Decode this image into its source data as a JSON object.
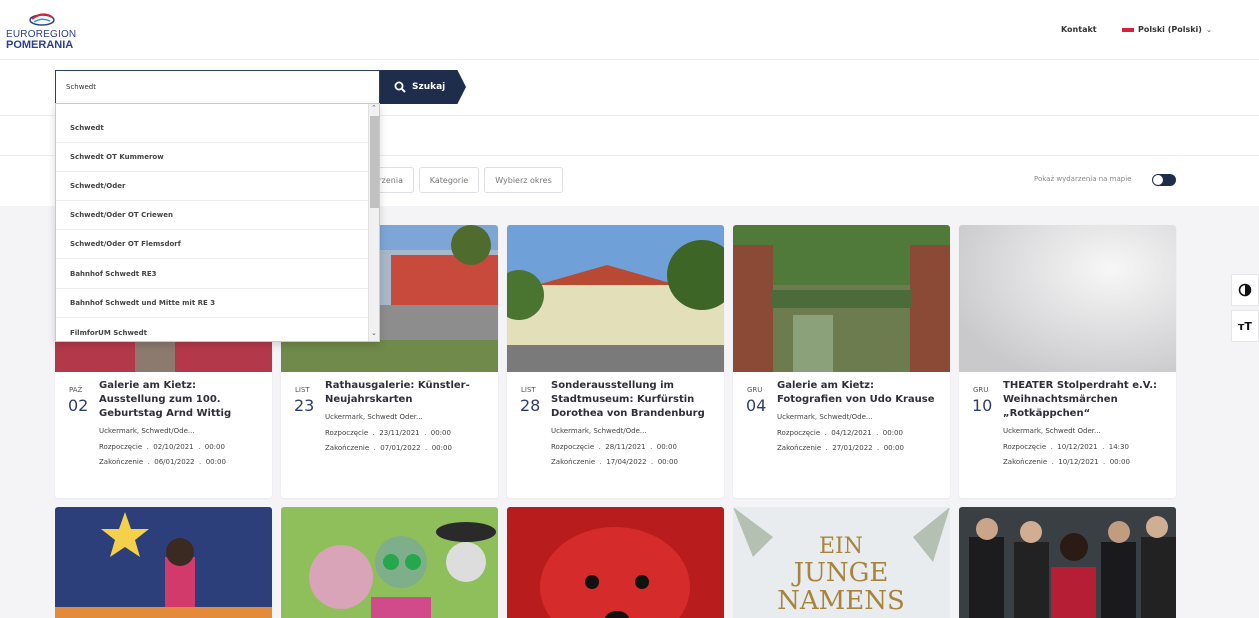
{
  "header": {
    "logo_line1": "EUROREGION",
    "logo_line2": "POMERANIA",
    "contact": "Kontakt",
    "language": "Polski (Polski)"
  },
  "search": {
    "value": "Schwedt",
    "button_label": "Szukaj",
    "suggestions": [
      "Schwedt",
      "Schwedt OT Kummerow",
      "Schwedt/Oder",
      "Schwedt/Oder OT Criewen",
      "Schwedt/Oder OT Flemsdorf",
      "Bahnhof Schwedt RE3",
      "Bahnhof Schwedt und Mitte mit RE 3",
      "FilmforUM Schwedt"
    ]
  },
  "filters": {
    "type_partial": "rzenia",
    "category": "Kategorie",
    "period": "Wybierz okres",
    "map_toggle_label": "Pokaż wydarzenia na mapie"
  },
  "side": {
    "contrast_icon": "contrast-icon",
    "font_size_icon": "font-size-icon",
    "font_size_glyph": "тT"
  },
  "events": [
    {
      "month": "PAŹ",
      "day": "02",
      "title": "Galerie am Kietz: Ausstellung zum 100. Geburtstag Arnd Wittig",
      "location": "Uckermark, Schwedt/Ode...",
      "start": "Rozpoczęcie  .  02/10/2021  .  00:00",
      "end": "Zakończenie  .  06/01/2022  .  00:00"
    },
    {
      "month": "LIST",
      "day": "23",
      "title": "Rathausgalerie: Künstler-Neujahrskarten",
      "location": "Uckermark, Schwedt Oder...",
      "start": "Rozpoczęcie  .  23/11/2021  .  00:00",
      "end": "Zakończenie  .  07/01/2022  .  00:00"
    },
    {
      "month": "LIST",
      "day": "28",
      "title": "Sonderausstellung im Stadtmuseum: Kurfürstin Dorothea von Brandenburg",
      "location": "Uckermark, Schwedt/Ode...",
      "start": "Rozpoczęcie  .  28/11/2021  .  00:00",
      "end": "Zakończenie  .  17/04/2022  .  00:00"
    },
    {
      "month": "GRU",
      "day": "04",
      "title": "Galerie am Kietz: Fotografien von Udo Krause",
      "location": "Uckermark, Schwedt/Ode...",
      "start": "Rozpoczęcie  .  04/12/2021  .  00:00",
      "end": "Zakończenie  .  27/01/2022  .  00:00"
    },
    {
      "month": "GRU",
      "day": "10",
      "title": "THEATER Stolperdraht e.V.: Weihnachtsmärchen „Rotkäppchen“",
      "location": "Uckermark, Schwedt Oder...",
      "start": "Rozpoczęcie  .  10/12/2021  .  14:30",
      "end": "Zakończenie  .  10/12/2021  .  00:00"
    }
  ],
  "posters": {
    "ein_junge_line1": "EIN",
    "ein_junge_line2": "JUNGE",
    "ein_junge_line3": "NAMENS"
  },
  "colors": {
    "navy": "#1f2d4d",
    "accent_red": "#d4213d"
  }
}
